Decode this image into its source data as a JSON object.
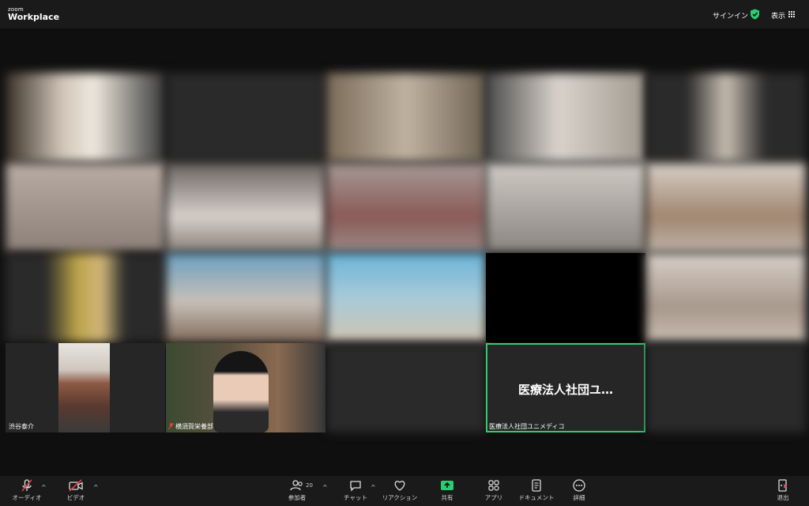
{
  "app": {
    "logo_top": "zoom",
    "logo_bottom": "Workplace"
  },
  "header": {
    "signin": "サインイン",
    "view": "表示"
  },
  "tiles": {
    "bottom_left_name": "渋谷泰介",
    "bottom_second_name": "横須賀栄養部",
    "active_big_name": "医療法人社団ユ…",
    "active_small_name": "医療法人社団ユニメディコ"
  },
  "toolbar": {
    "audio": "オーディオ",
    "video": "ビデオ",
    "participants": "参加者",
    "participants_count": "20",
    "chat": "チャット",
    "reaction": "リアクション",
    "share": "共有",
    "apps": "アプリ",
    "docs": "ドキュメント",
    "more": "詳細",
    "leave": "退出"
  },
  "colors": {
    "accent_green": "#2ecc71",
    "mute_red": "#e0424b"
  }
}
